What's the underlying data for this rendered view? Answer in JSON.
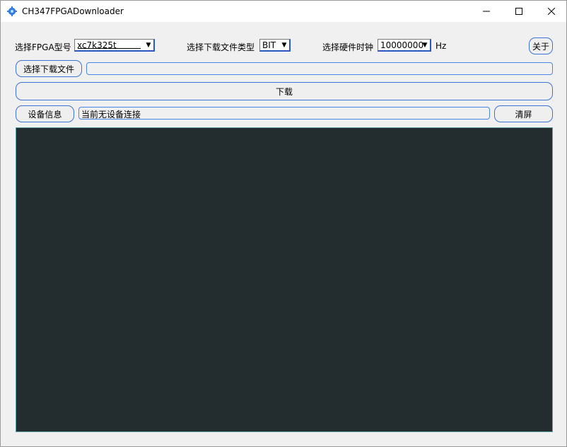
{
  "window": {
    "title": "CH347FPGADownloader"
  },
  "controls": {
    "fpga_model_label": "选择FPGA型号",
    "fpga_model_value": "xc7k325t",
    "file_type_label": "选择下载文件类型",
    "file_type_value": "BIT",
    "clock_label": "选择硬件时钟",
    "clock_value": "10000000",
    "clock_unit": "Hz",
    "about_button": "关于",
    "select_file_button": "选择下载文件",
    "file_path_value": "",
    "download_button": "下载",
    "device_info_button": "设备信息",
    "device_status": "当前无设备连接",
    "clear_button": "清屏"
  },
  "colors": {
    "accent": "#3b73d6",
    "console_bg": "#232c2e"
  },
  "icons": [
    "app-gear-icon",
    "minimize-icon",
    "maximize-icon",
    "close-icon",
    "chevron-down-icon"
  ]
}
